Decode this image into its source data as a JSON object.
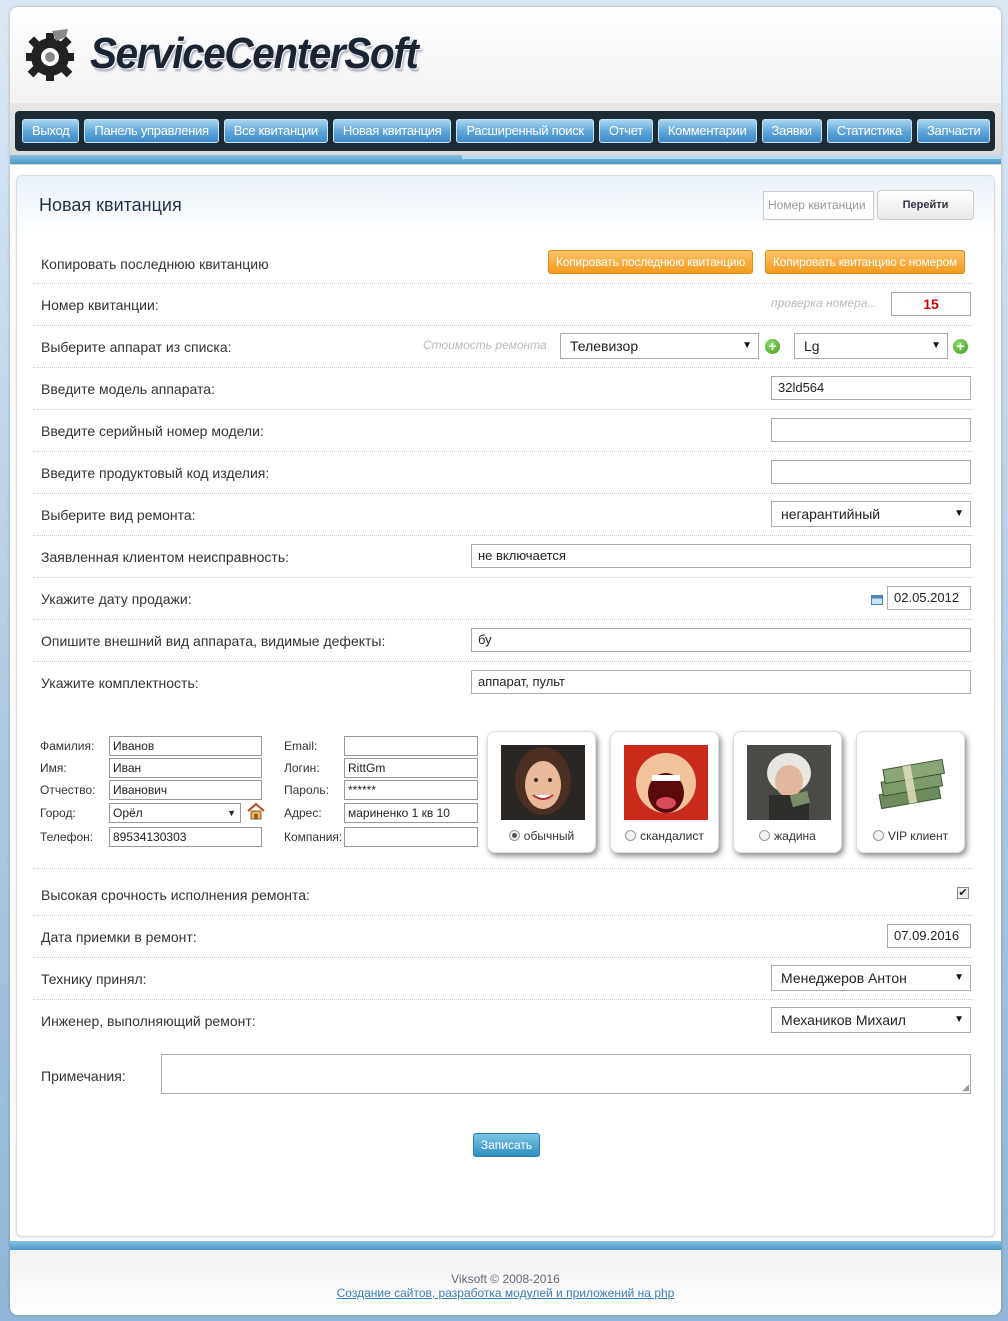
{
  "app": {
    "logo_text": "ServiceCenterSoft"
  },
  "nav": {
    "items": [
      "Выход",
      "Панель управления",
      "Все квитанции",
      "Новая квитанция",
      "Расширенный поиск",
      "Отчет",
      "Комментарии",
      "Заявки",
      "Статистика",
      "Запчасти"
    ]
  },
  "header": {
    "title": "Новая квитанция",
    "receipt_search_placeholder": "Номер квитанции",
    "go_button": "Перейти"
  },
  "form": {
    "copy_label": "Копировать последнюю квитанцию",
    "copy_last_button": "Копировать последнюю квитанцию",
    "copy_by_number_button": "Копировать квитанцию с номером",
    "number_label": "Номер квитанции:",
    "number_hint": "проверка номера...",
    "number_value": "15",
    "device_label": "Выберите аппарат из списка:",
    "repair_cost_hint": "Стоимость ремонта",
    "device_value": "Телевизор",
    "brand_value": "Lg",
    "model_label": "Введите модель аппарата:",
    "model_value": "32ld564",
    "serial_label": "Введите серийный номер модели:",
    "serial_value": "",
    "product_code_label": "Введите продуктовый код изделия:",
    "product_code_value": "",
    "repair_type_label": "Выберите вид ремонта:",
    "repair_type_value": "негарантийный",
    "fault_label": "Заявленная клиентом неисправность:",
    "fault_value": "не включается",
    "sale_date_label": "Укажите дату продажи:",
    "sale_date_value": "02.05.2012",
    "appearance_label": "Опишите внешний вид аппарата, видимые дефекты:",
    "appearance_value": "бу",
    "kit_label": "Укажите комплектность:",
    "kit_value": "аппарат, пульт",
    "urgent_label": "Высокая срочность исполнения ремонта:",
    "urgent_checked": true,
    "accept_date_label": "Дата приемки в ремонт:",
    "accept_date_value": "07.09.2016",
    "accepted_by_label": "Технику принял:",
    "accepted_by_value": "Менеджеров Антон",
    "engineer_label": "Инженер, выполняющий ремонт:",
    "engineer_value": "Механиков Михаил",
    "notes_label": "Примечания:",
    "notes_value": "",
    "save_button": "Записать"
  },
  "client": {
    "surname_label": "Фамилия:",
    "surname_value": "Иванов",
    "name_label": "Имя:",
    "name_value": "Иван",
    "patronymic_label": "Отчество:",
    "patronymic_value": "Иванович",
    "city_label": "Город:",
    "city_value": "Орёл",
    "phone_label": "Телефон:",
    "phone_value": "89534130303",
    "email_label": "Email:",
    "email_value": "",
    "login_label": "Логин:",
    "login_value": "RittGm",
    "password_label": "Пароль:",
    "password_value": "******",
    "address_label": "Адрес:",
    "address_value": "мариненко 1 кв 10",
    "company_label": "Компания:",
    "company_value": ""
  },
  "client_types": [
    {
      "label": "обычный",
      "selected": true
    },
    {
      "label": "скандалист",
      "selected": false
    },
    {
      "label": "жадина",
      "selected": false
    },
    {
      "label": "VIP клиент",
      "selected": false
    }
  ],
  "footer": {
    "copyright": "Viksoft © 2008-2016",
    "link": "Создание сайтов, разработка модулей и приложений на php"
  },
  "colors": {
    "nav_button": "#5ca4d7",
    "accent_orange": "#f49a1b",
    "number_red": "#cc0000"
  }
}
